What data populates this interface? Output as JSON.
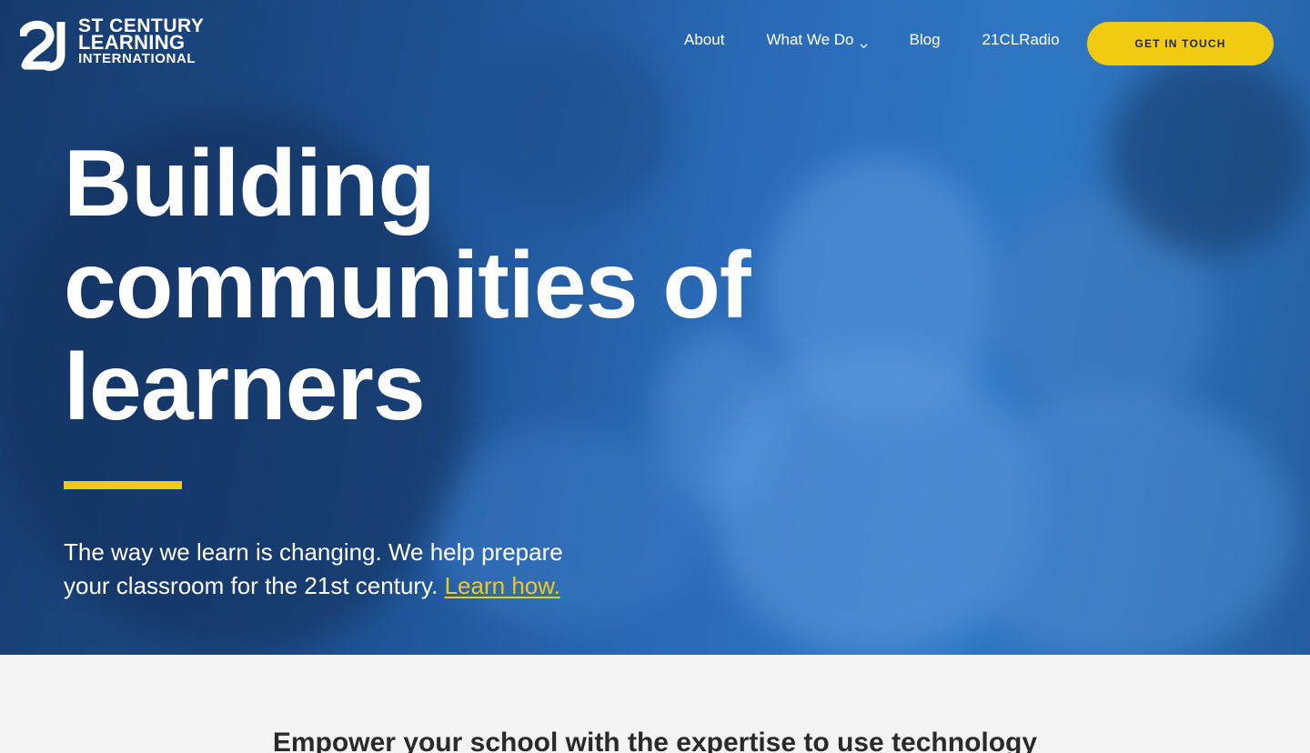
{
  "brand": {
    "mark": "21",
    "line1": "ST CENTURY",
    "line2": "LEARNING",
    "line3": "INTERNATIONAL"
  },
  "nav": {
    "items": [
      {
        "label": "About"
      },
      {
        "label": "What We Do",
        "has_dropdown": true
      },
      {
        "label": "Blog"
      },
      {
        "label": "21CLRadio"
      }
    ],
    "cta": "GET IN TOUCH"
  },
  "hero": {
    "headline_lines": [
      "Building",
      "communities of",
      "learners"
    ],
    "subtext": "The way we learn is changing. We help prepare your classroom for the 21st century.",
    "link": "Learn how."
  },
  "section": {
    "title": "Empower your school with the expertise to use technology"
  },
  "colors": {
    "accent": "#f2ca12",
    "hero_blue": "#2a6bb8"
  }
}
